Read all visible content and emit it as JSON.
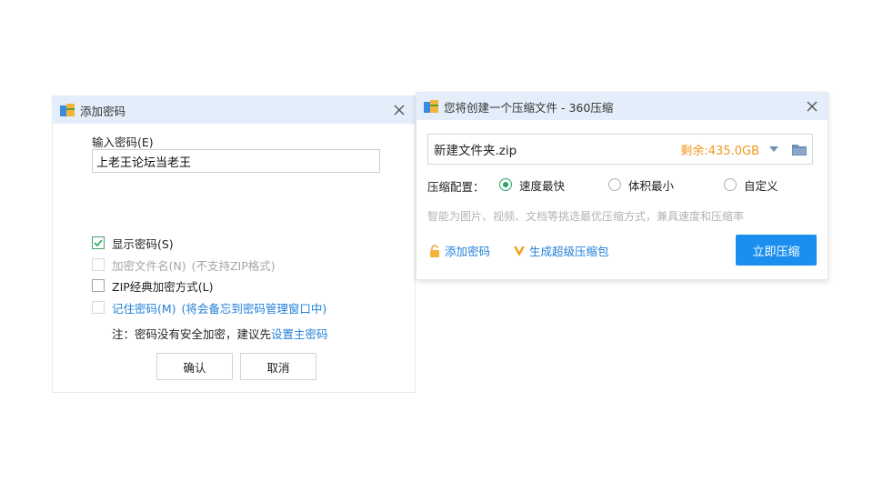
{
  "password_dialog": {
    "title": "添加密码",
    "input_label": "输入密码(E)",
    "password_value": "上老王论坛当老王",
    "show_password": "显示密码(S)",
    "encrypt_filename": "加密文件名(N)",
    "encrypt_filename_note": "(不支持ZIP格式)",
    "zip_classic": "ZIP经典加密方式(L)",
    "remember_password": "记住密码(M)",
    "remember_password_note": "(将会备忘到密码管理窗口中)",
    "note_text": "注：密码没有安全加密，建议先",
    "note_link": "设置主密码",
    "ok_button": "确认",
    "cancel_button": "取消"
  },
  "zip_dialog": {
    "title": "您将创建一个压缩文件 - 360压缩",
    "filename": "新建文件夹.zip",
    "free_space": "剩余:435.0GB",
    "config_label": "压缩配置：",
    "options": [
      "速度最快",
      "体积最小",
      "自定义"
    ],
    "selected_option": "速度最快",
    "hint": "智能为图片、视频、文档等挑选最优压缩方式，兼具速度和压缩率",
    "add_password_link": "添加密码",
    "super_package_link": "生成超级压缩包",
    "compress_button": "立即压缩"
  },
  "colors": {
    "accent": "#1b8ff0",
    "link": "#1f7fd9",
    "free_space": "#f0961e",
    "radio_selected": "#2aa160",
    "titlebar": "#e4eefa"
  }
}
